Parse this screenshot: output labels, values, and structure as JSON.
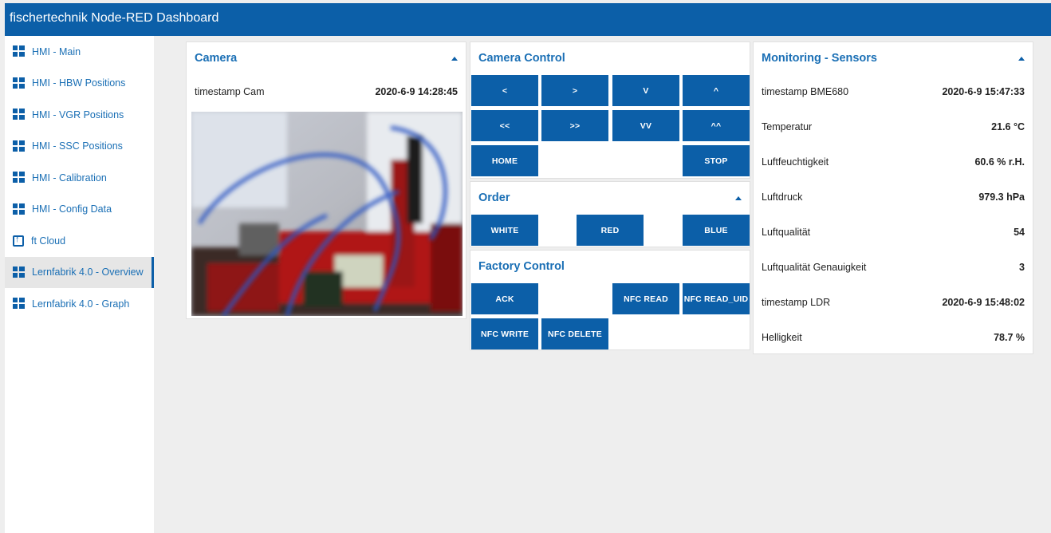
{
  "header": {
    "title": "fischertechnik Node-RED Dashboard"
  },
  "sidebar": {
    "items": [
      {
        "label": "HMI - Main",
        "icon": "dashboard-icon"
      },
      {
        "label": "HMI - HBW Positions",
        "icon": "dashboard-icon"
      },
      {
        "label": "HMI - VGR Positions",
        "icon": "dashboard-icon"
      },
      {
        "label": "HMI - SSC Positions",
        "icon": "dashboard-icon"
      },
      {
        "label": "HMI - Calibration",
        "icon": "dashboard-icon"
      },
      {
        "label": "HMI - Config Data",
        "icon": "dashboard-icon"
      },
      {
        "label": "ft Cloud",
        "icon": "external-link-icon"
      },
      {
        "label": "Lernfabrik 4.0 - Overview",
        "icon": "dashboard-icon",
        "active": true
      },
      {
        "label": "Lernfabrik 4.0 - Graph",
        "icon": "dashboard-icon"
      }
    ]
  },
  "camera": {
    "title": "Camera",
    "timestamp_label": "timestamp Cam",
    "timestamp_value": "2020-6-9 14:28:45"
  },
  "camera_control": {
    "title": "Camera Control",
    "buttons": {
      "left": "<",
      "right": ">",
      "down": "V",
      "up": "^",
      "left2": "<<",
      "right2": ">>",
      "down2": "VV",
      "up2": "^^",
      "home": "HOME",
      "stop": "STOP"
    }
  },
  "order": {
    "title": "Order",
    "white": "WHITE",
    "red": "RED",
    "blue": "BLUE"
  },
  "factory_control": {
    "title": "Factory Control",
    "ack": "ACK",
    "nfc_read": "NFC READ",
    "nfc_read_uid": "NFC READ_UID",
    "nfc_write": "NFC WRITE",
    "nfc_delete": "NFC DELETE"
  },
  "monitoring": {
    "title": "Monitoring - Sensors",
    "rows": [
      {
        "label": "timestamp BME680",
        "value": "2020-6-9 15:47:33"
      },
      {
        "label": "Temperatur",
        "value": "21.6 °C"
      },
      {
        "label": "Luftfeuchtigkeit",
        "value": "60.6 % r.H."
      },
      {
        "label": "Luftdruck",
        "value": "979.3 hPa"
      },
      {
        "label": "Luftqualität",
        "value": "54"
      },
      {
        "label": "Luftqualität Genauigkeit",
        "value": "3"
      },
      {
        "label": "timestamp LDR",
        "value": "2020-6-9 15:48:02"
      },
      {
        "label": "Helligkeit",
        "value": "78.7 %"
      }
    ]
  },
  "colors": {
    "accent": "#0c5fa8",
    "link": "#1a6fb5",
    "background": "#eeeeee"
  }
}
